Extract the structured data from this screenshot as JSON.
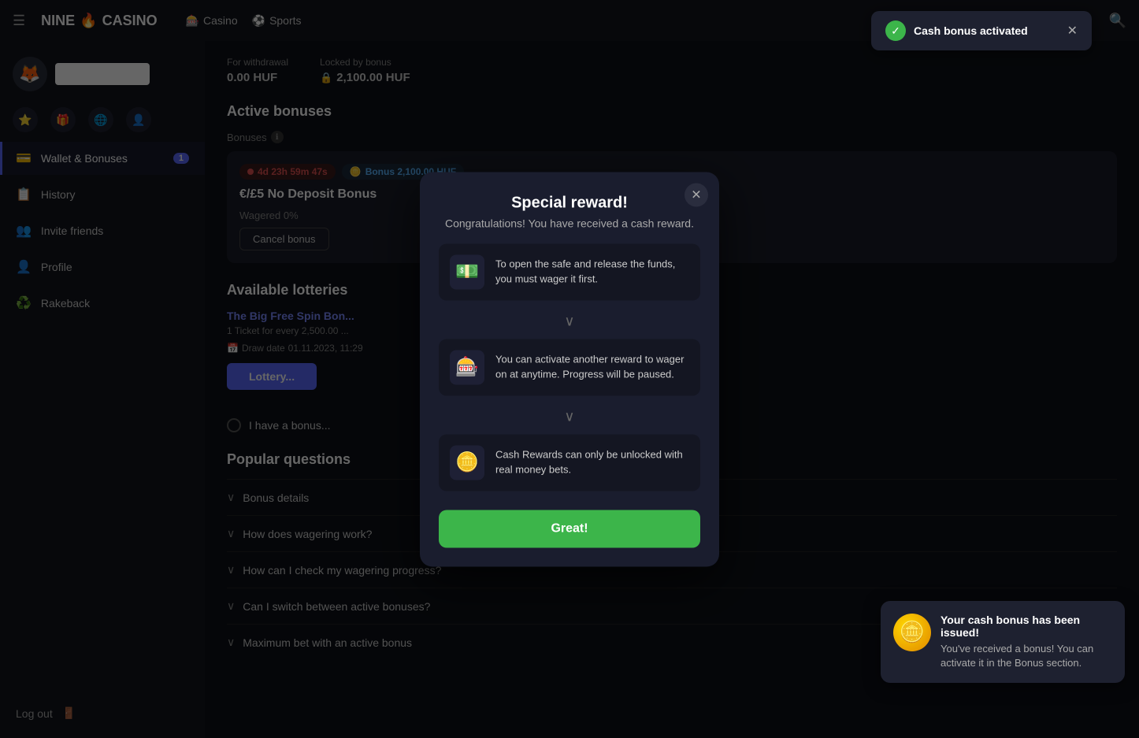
{
  "nav": {
    "menu_icon": "☰",
    "logo_text": "NINE",
    "logo_flame": "🔥",
    "logo_suffix": "CASINO",
    "links": [
      {
        "label": "Casino",
        "icon": "🎰"
      },
      {
        "label": "Sports",
        "icon": "⚽"
      }
    ],
    "search_icon": "🔍"
  },
  "sidebar": {
    "avatar_emoji": "🦊",
    "nav_items": [
      {
        "label": "Wallet & Bonuses",
        "icon": "💳",
        "active": true,
        "badge": "1"
      },
      {
        "label": "History",
        "icon": "📋",
        "active": false,
        "badge": ""
      },
      {
        "label": "Invite friends",
        "icon": "👥",
        "active": false,
        "badge": ""
      },
      {
        "label": "Profile",
        "icon": "👤",
        "active": false,
        "badge": ""
      },
      {
        "label": "Rakeback",
        "icon": "♻️",
        "active": false,
        "badge": ""
      }
    ],
    "logout_label": "Log out",
    "logout_icon": "🚪"
  },
  "balance": {
    "for_withdrawal_label": "For withdrawal",
    "for_withdrawal_amount": "0.00 HUF",
    "locked_by_bonus_label": "Locked by bonus",
    "locked_by_bonus_amount": "2,100.00 HUF",
    "lock_icon": "🔒"
  },
  "active_bonuses": {
    "section_title": "Active bonuses",
    "bonuses_label": "Bonuses",
    "timer_tag": "4d 23h 59m 47s",
    "amount_tag": "Bonus 2,100.00 HUF",
    "bonus_title": "€/£5 No Deposit Bonus",
    "wagered_label": "Wagered 0%",
    "cancel_btn": "Cancel bonus"
  },
  "lotteries": {
    "section_title": "Available lotteries",
    "lottery_name": "The Big Free Spin Bon...",
    "lottery_sub": "1 Ticket for every 2,500.00 ...",
    "draw_label": "Draw date",
    "draw_date": "01.11.2023, 11:29",
    "lottery_btn": "Lottery..."
  },
  "bonus_toggle": {
    "label": "I have a bonus..."
  },
  "faq": {
    "section_title": "Popular questions",
    "items": [
      {
        "label": "Bonus details"
      },
      {
        "label": "How does wagering work?"
      },
      {
        "label": "How can I check my wagering progress?"
      },
      {
        "label": "Can I switch between active bonuses?"
      },
      {
        "label": "Maximum bet with an active bonus"
      }
    ]
  },
  "modal": {
    "title": "Special reward!",
    "subtitle": "Congratulations! You have received a cash reward.",
    "close_icon": "✕",
    "info_items": [
      {
        "icon": "💵",
        "text": "To open the safe and release the funds, you must wager it first."
      },
      {
        "icon": "🎰",
        "text": "You can activate another reward to wager on at anytime. Progress will be paused."
      },
      {
        "icon": "🪙",
        "text": "Cash Rewards can only be unlocked with real money bets."
      }
    ],
    "great_btn": "Great!"
  },
  "toast_top": {
    "message": "Cash bonus activated",
    "check_icon": "✓",
    "close_icon": "✕"
  },
  "toast_bottom": {
    "title": "Your cash bonus has been issued!",
    "text": "You've received a bonus! You can activate it in the Bonus section.",
    "coin_icon": "🪙"
  }
}
